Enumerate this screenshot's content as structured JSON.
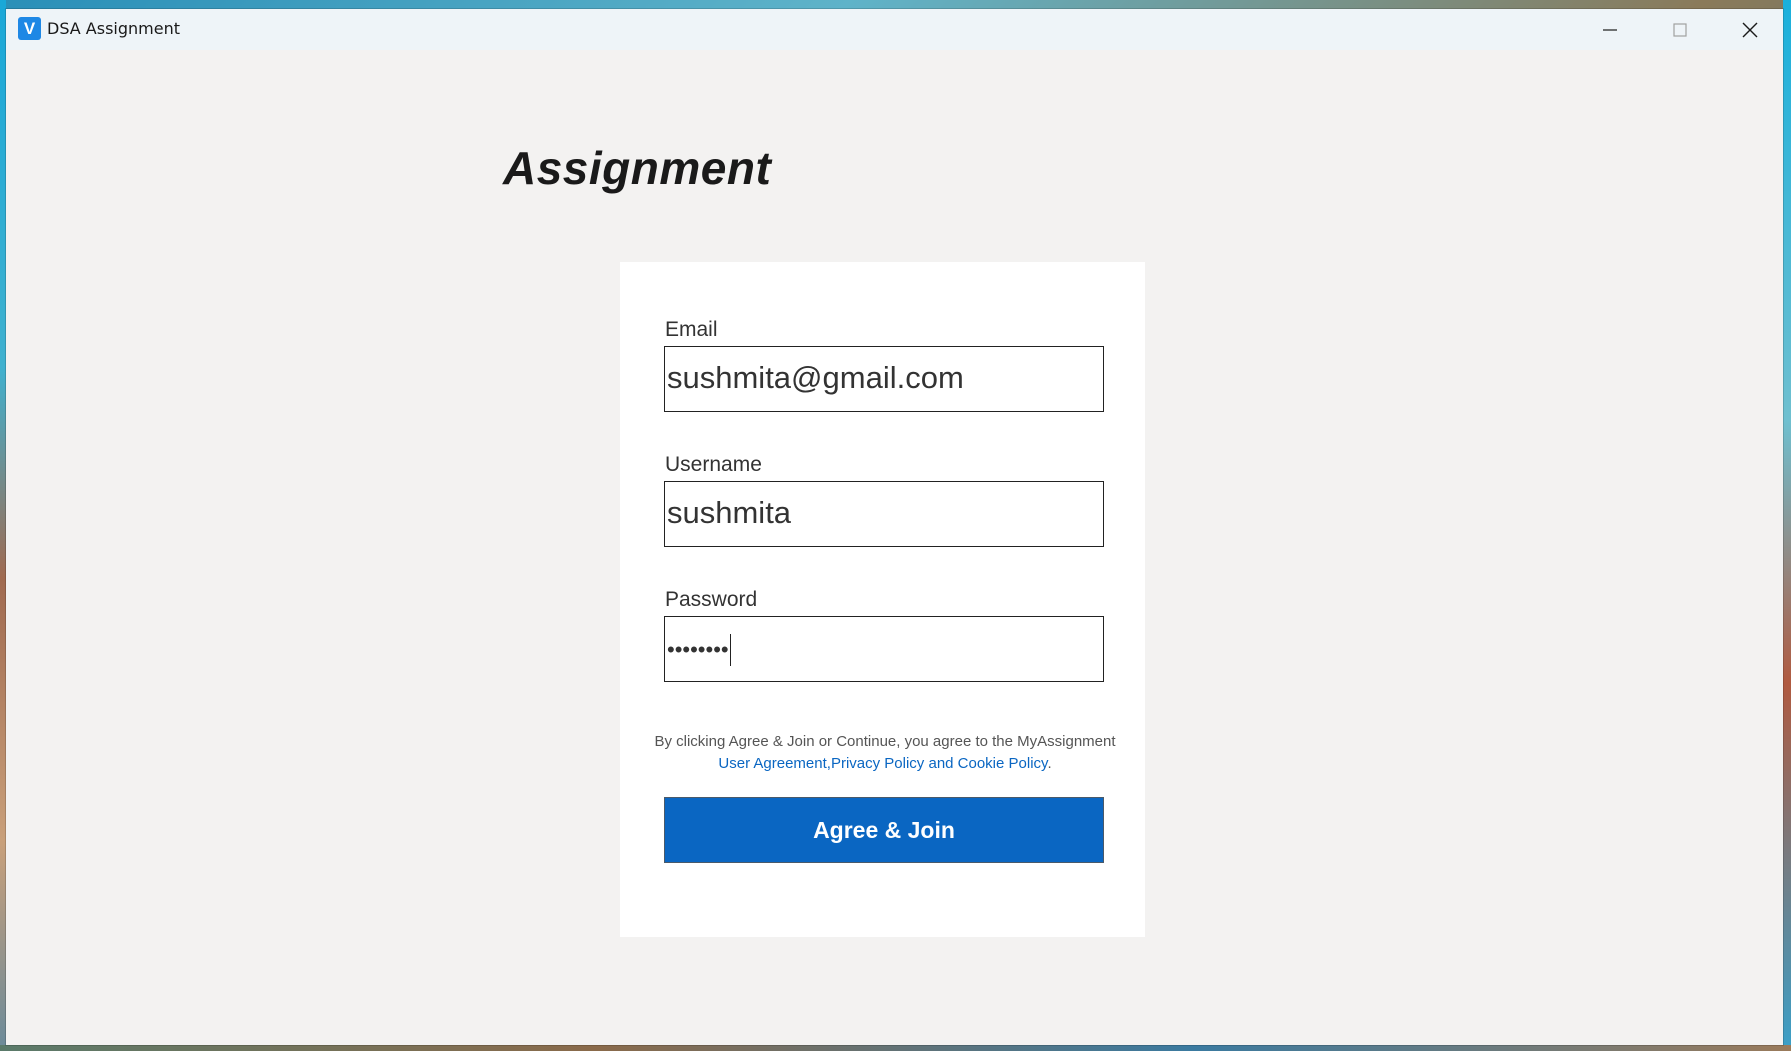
{
  "window": {
    "title": "DSA Assignment",
    "icon_letter": "V"
  },
  "controls": {
    "minimize_icon": "minimize-icon",
    "maximize_icon": "maximize-icon",
    "close_icon": "close-icon"
  },
  "page": {
    "heading": "Assignment"
  },
  "form": {
    "email": {
      "label": "Email",
      "value": "sushmita@gmail.com"
    },
    "username": {
      "label": "Username",
      "value": "sushmita"
    },
    "password": {
      "label": "Password",
      "masked_value": "••••••••"
    },
    "agreement": {
      "text": "By clicking Agree & Join or Continue, you agree to the MyAssignment",
      "link_user_agreement": "User Agreement,",
      "link_policies": "Privacy Policy and Cookie Policy",
      "period": "."
    },
    "submit_label": "Agree & Join"
  },
  "colors": {
    "window_bg": "#f3f2f1",
    "card_bg": "#ffffff",
    "accent": "#0a66c2",
    "app_icon": "#1e88e5"
  }
}
